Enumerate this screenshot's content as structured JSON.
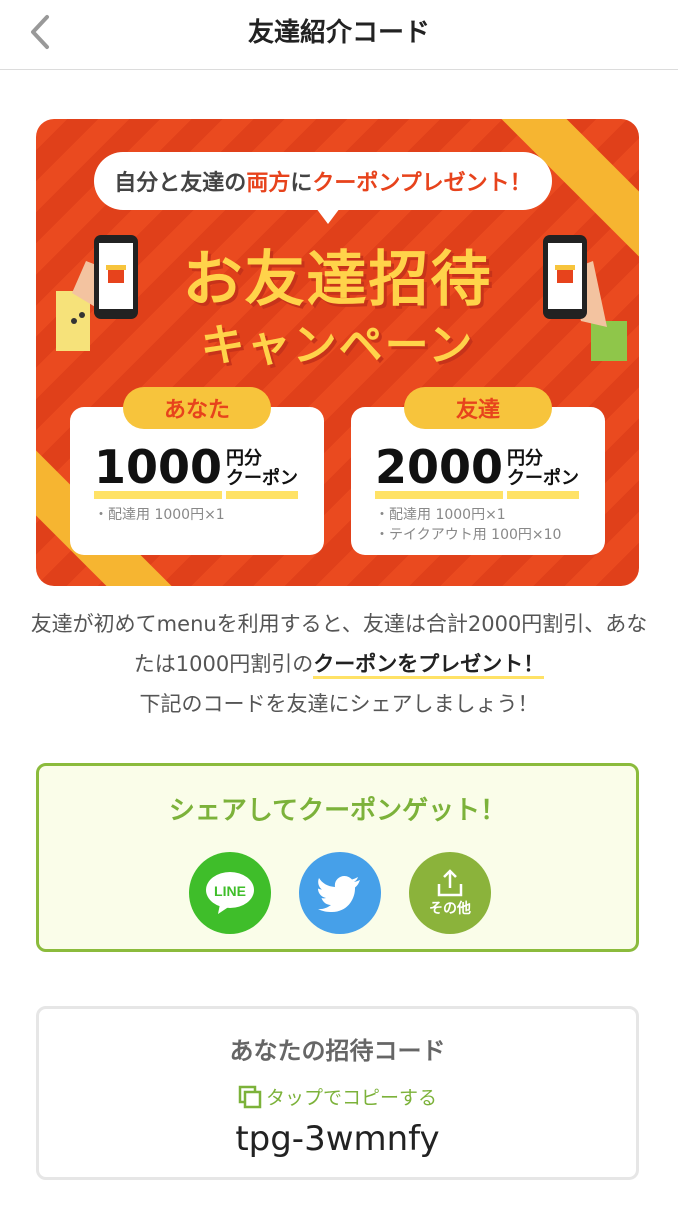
{
  "header": {
    "title": "友達紹介コード",
    "back_icon": "chevron-left-icon"
  },
  "banner": {
    "bubble": {
      "part1": "自分と友達の",
      "part2": "両方",
      "part3": "に",
      "part4": "クーポンプレゼント！"
    },
    "campaign_line1": "お友達招待",
    "campaign_line2": "キャンペーン",
    "you": {
      "tag": "あなた",
      "amount": "1000",
      "unit1": "円分",
      "unit2": "クーポン",
      "note1": "・配達用 1000円×1"
    },
    "friend": {
      "tag": "友達",
      "amount": "2000",
      "unit1": "円分",
      "unit2": "クーポン",
      "note1": "・配達用 1000円×1",
      "note2": "・テイクアウト用 100円×10"
    }
  },
  "description": {
    "text1": "友達が初めてmenuを利用すると、友達は合計2000円割引、あなたは1000円割引の",
    "emphasis": "クーポンをプレゼント！",
    "text2": "下記のコードを友達にシェアしましょう！"
  },
  "share": {
    "heading": "シェアしてクーポンゲット！",
    "line_label": "LINE",
    "other_label": "その他"
  },
  "invite": {
    "label": "あなたの招待コード",
    "copy_label": "タップでコピーする",
    "code": "tpg-3wmnfy"
  },
  "colors": {
    "accent_green": "#7cb23a",
    "banner_red": "#ea4a1f",
    "yellow": "#ffd34a",
    "line_green": "#3fbe2a",
    "twitter_blue": "#46a0e9"
  }
}
